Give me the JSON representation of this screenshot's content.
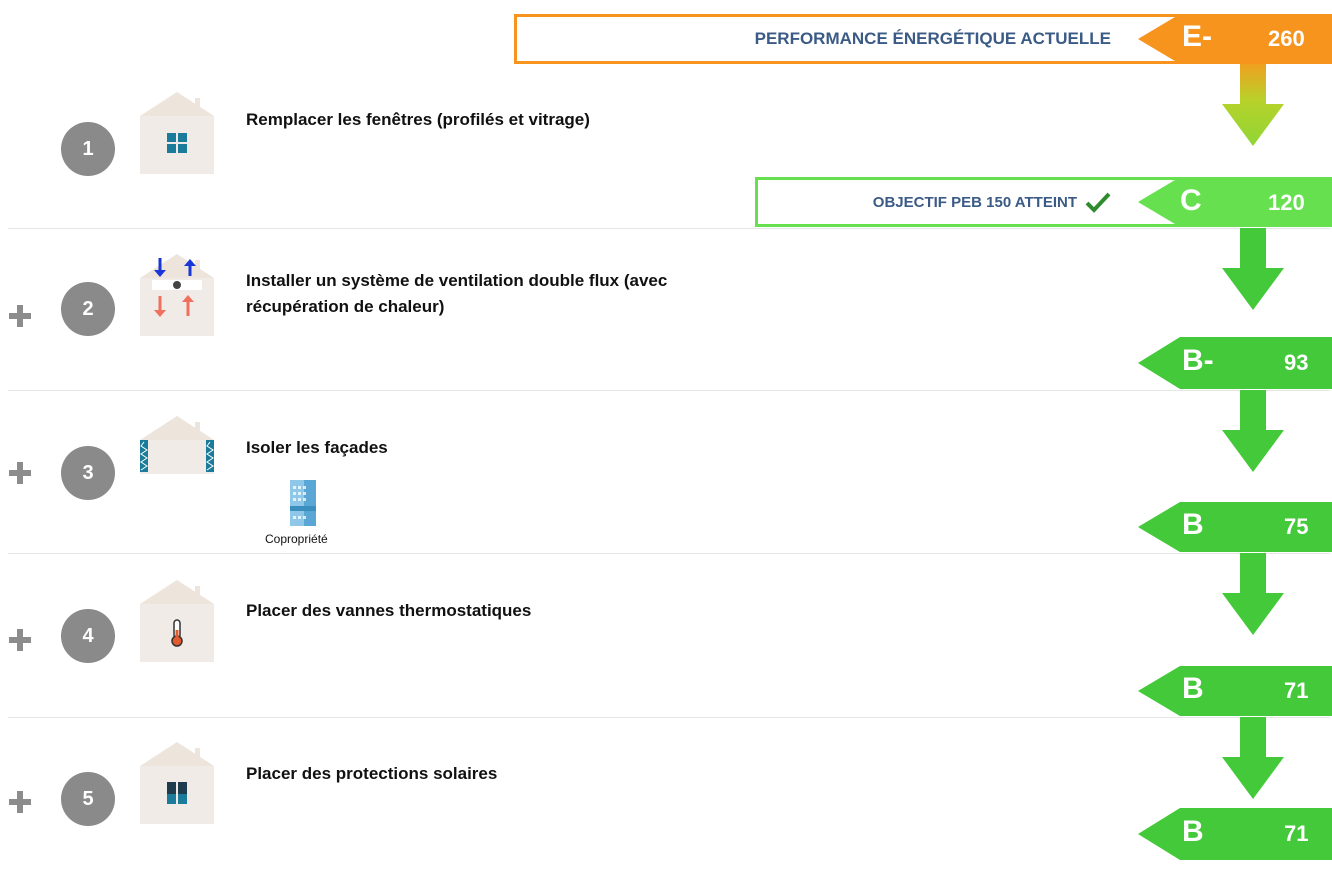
{
  "current": {
    "label": "PERFORMANCE ÉNERGÉTIQUE ACTUELLE",
    "grade": "E-",
    "value": "260",
    "color": "#f7941d"
  },
  "objective": {
    "label": "OBJECTIF PEB 150 ATTEINT",
    "grade": "C",
    "value": "120",
    "color": "#66e04f",
    "check_icon": "check-icon"
  },
  "steps": [
    {
      "number": "1",
      "title": "Remplacer les fenêtres (profilés et vitrage)",
      "icon": "window-house-icon"
    },
    {
      "number": "2",
      "title_line1": "Installer un système de ventilation double flux (avec",
      "title_line2": "récupération de chaleur)",
      "icon": "ventilation-house-icon"
    },
    {
      "number": "3",
      "title": "Isoler les façades",
      "icon": "insulated-house-icon",
      "badge": "Copropriété"
    },
    {
      "number": "4",
      "title": "Placer des vannes thermostatiques",
      "icon": "thermometer-house-icon"
    },
    {
      "number": "5",
      "title": "Placer des protections solaires",
      "icon": "shutter-house-icon"
    }
  ],
  "results": [
    {
      "grade": "B-",
      "value": "93"
    },
    {
      "grade": "B",
      "value": "75"
    },
    {
      "grade": "B",
      "value": "71"
    },
    {
      "grade": "B",
      "value": "71"
    }
  ],
  "colors": {
    "green": "#44c93a",
    "orange": "#f7941d",
    "circle_gray": "#8a8a8a",
    "house_wall": "#f0ebe6",
    "banner_text": "#3b5b86"
  }
}
